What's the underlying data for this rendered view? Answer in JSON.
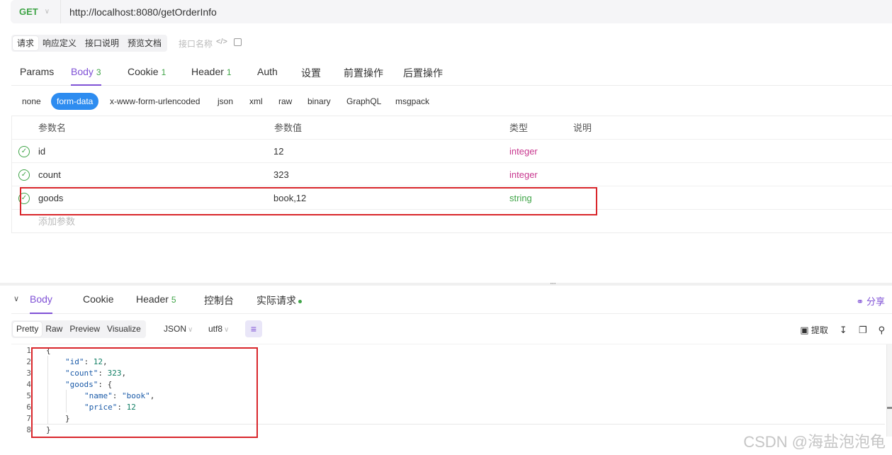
{
  "request": {
    "method": "GET",
    "url": "http://localhost:8080/getOrderInfo"
  },
  "doc_tabs": [
    "请求",
    "响应定义",
    "接口说明",
    "预览文档"
  ],
  "doc_name_placeholder": "接口名称",
  "request_tabs": [
    {
      "label": "Params"
    },
    {
      "label": "Body",
      "count": "3"
    },
    {
      "label": "Cookie",
      "count": "1"
    },
    {
      "label": "Header",
      "count": "1"
    },
    {
      "label": "Auth"
    },
    {
      "label": "设置"
    },
    {
      "label": "前置操作"
    },
    {
      "label": "后置操作"
    }
  ],
  "body_types": [
    "none",
    "form-data",
    "x-www-form-urlencoded",
    "json",
    "xml",
    "raw",
    "binary",
    "GraphQL",
    "msgpack"
  ],
  "params_table": {
    "headers": [
      "参数名",
      "参数值",
      "类型",
      "说明"
    ],
    "rows": [
      {
        "name": "id",
        "value": "12",
        "type": "integer"
      },
      {
        "name": "count",
        "value": "323",
        "type": "integer"
      },
      {
        "name": "goods",
        "value": "book,12",
        "type": "string"
      }
    ],
    "add_placeholder": "添加参数"
  },
  "response_tabs": [
    {
      "label": "Body"
    },
    {
      "label": "Cookie"
    },
    {
      "label": "Header",
      "count": "5"
    },
    {
      "label": "控制台"
    },
    {
      "label": "实际请求"
    }
  ],
  "share_label": "分享",
  "format_tabs": [
    "Pretty",
    "Raw",
    "Preview",
    "Visualize"
  ],
  "format_select": "JSON",
  "encoding_select": "utf8",
  "extract_label": "提取",
  "code": {
    "line_numbers": [
      "1",
      "2",
      "3",
      "4",
      "5",
      "6",
      "7",
      "8"
    ],
    "l1": "{",
    "l2_key": "\"id\"",
    "l2_val": "12",
    "l3_key": "\"count\"",
    "l3_val": "323",
    "l4_key": "\"goods\"",
    "l4_rest": ": {",
    "l5_key": "\"name\"",
    "l5_val": "\"book\"",
    "l6_key": "\"price\"",
    "l6_val": "12",
    "l7": "}",
    "l8": "}"
  },
  "watermark": "CSDN @海盐泡泡龟",
  "colors": {
    "accent": "#8052d6",
    "method_get": "#3fa447",
    "type_integer": "#c8388f",
    "type_string": "#3fa447",
    "active_pill": "#2d8cf0",
    "highlight_border": "#d9262b"
  }
}
